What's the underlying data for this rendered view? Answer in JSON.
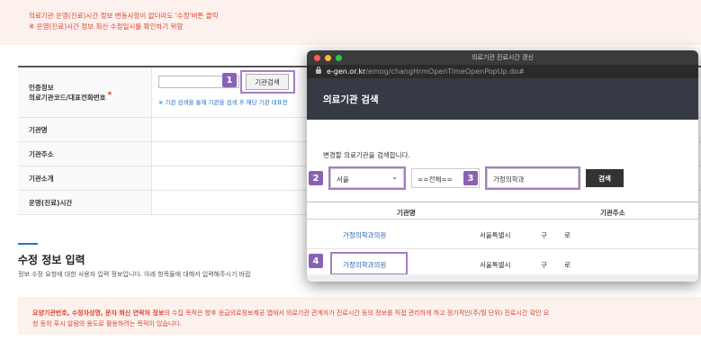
{
  "notice_top": {
    "line1": "의료기관 운영(진료)시간 정보 변동사항이 없더라도 '수정'버튼 클릭",
    "line2": "※ 운영(진료)시간 정보 최신 수정일시를 확인하기 위함"
  },
  "form": {
    "auth_label_1": "인증정보",
    "auth_label_2": "의료기관코드/대표전화번호",
    "required_mark": "*",
    "search_button": "기관검색",
    "hint": "※ 기관 검색을 통해 기관을 검색 후 해당 기관 대표전",
    "rows": [
      "기관명",
      "기관주소",
      "기관소개",
      "운영(진료)시간"
    ]
  },
  "section": {
    "title": "수정 정보 입력",
    "desc": "정보 수정 요청에 대한 사용자 입력 정보입니다. 아래 항목들에 대해서 입력해주시기 바랍"
  },
  "notice_bottom": {
    "bold_part": "요양기관번호, 수정자성명, 문자 회신 연락처 정보",
    "rest_part": "의 수집 목적은 향후 응급의료정보제공 앱에서 의료기관 관계자가 진료시간 등의 정보를 직접 관리하게 하고 정기적인(주/월 단위) 진료시간 확인 요",
    "line2": "청 등의 푸시 알람의 용도로 활용하려는 목적이 있습니다."
  },
  "markers": [
    "1",
    "2",
    "3",
    "4"
  ],
  "popup": {
    "window_title": "의료기관 진료시간 갱신",
    "url_host": "e-gen.or.kr",
    "url_path": "/emog/changHrmOpenTimeOpenPopUp.do#",
    "heading": "의료기관 검색",
    "description": "변경할 의료기관을 검색합니다.",
    "region_select": "서울",
    "district_select": "==전체==",
    "name_input": "가정의학과",
    "search_button": "검색",
    "col_name": "기관명",
    "col_address": "기관주소",
    "results": [
      {
        "name": "가정의학과의원",
        "city": "서울특별시",
        "gu": "구",
        "ro": "로"
      },
      {
        "name": "가정의학과의원",
        "city": "서울특별시",
        "gu": "구",
        "ro": "로"
      }
    ]
  },
  "colors": {
    "accent": "#8a62b4",
    "notice_text": "#d9452e",
    "notice_bg": "#fdf1ee",
    "link": "#2a72c4",
    "popup_header": "#353a45"
  }
}
